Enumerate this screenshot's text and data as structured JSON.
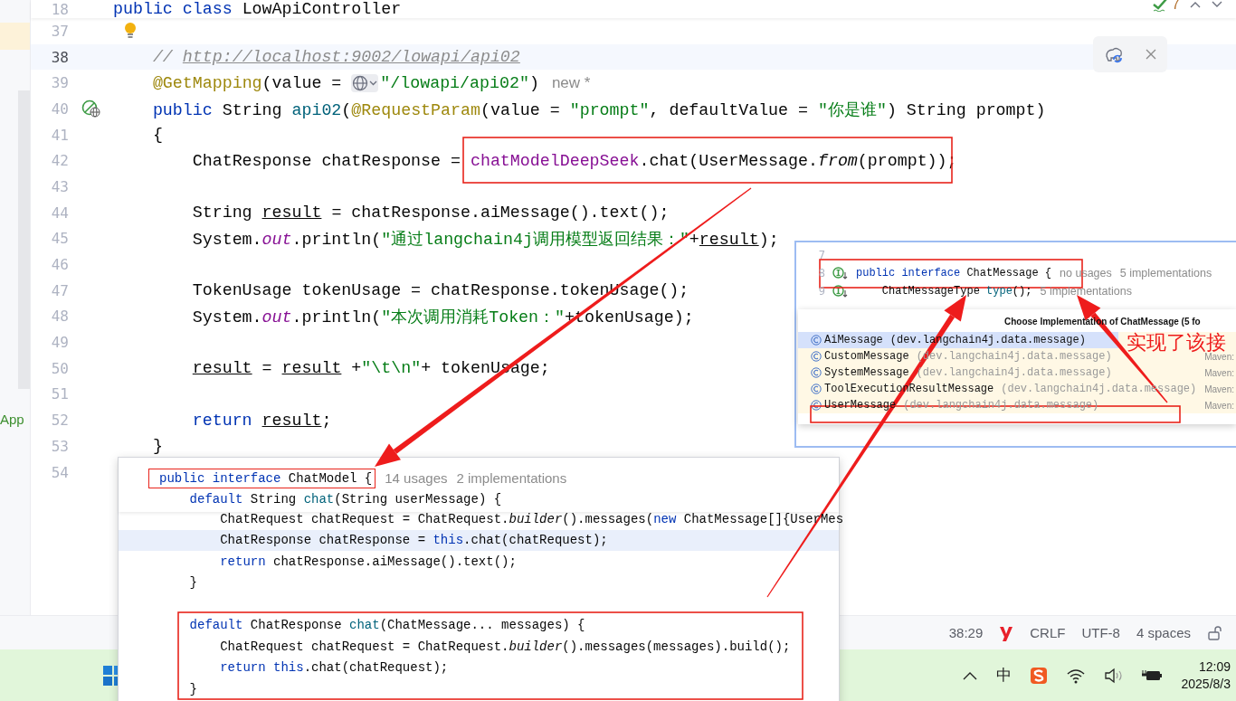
{
  "side_panel": {
    "label": "App"
  },
  "editor": {
    "sticky_line": {
      "number": "18",
      "current": false,
      "tokens": [
        {
          "kind": "kw",
          "text": "public class "
        },
        {
          "kind": "plain",
          "text": "LowApiController"
        }
      ]
    },
    "lines": [
      {
        "number": "37",
        "kind": "bulb",
        "current": false
      },
      {
        "number": "38",
        "kind": "plain",
        "current": true,
        "tokens": [
          {
            "kind": "comment",
            "text": "    // "
          },
          {
            "kind": "link",
            "text": "http://localhost:9002/lowapi/api02"
          }
        ]
      },
      {
        "number": "39",
        "kind": "plain",
        "current": false,
        "tokens": [
          {
            "kind": "ann",
            "text": "    @GetMapping"
          },
          {
            "kind": "plain",
            "text": "(value = "
          },
          {
            "kind": "globe"
          },
          {
            "kind": "str",
            "text": "\"/lowapi/api02\""
          },
          {
            "kind": "plain",
            "text": ")"
          }
        ],
        "hints": [
          "new *"
        ]
      },
      {
        "number": "40",
        "kind": "endpoint",
        "current": false,
        "tokens": [
          {
            "kind": "kw",
            "text": "    public "
          },
          {
            "kind": "plain",
            "text": "String "
          },
          {
            "kind": "decl",
            "text": "api02"
          },
          {
            "kind": "plain",
            "text": "("
          },
          {
            "kind": "ann",
            "text": "@RequestParam"
          },
          {
            "kind": "plain",
            "text": "(value = "
          },
          {
            "kind": "str",
            "text": "\"prompt\""
          },
          {
            "kind": "plain",
            "text": ", defaultValue = "
          },
          {
            "kind": "str",
            "text": "\"你是谁\""
          },
          {
            "kind": "plain",
            "text": ") String prompt)"
          }
        ]
      },
      {
        "number": "41",
        "kind": "plain",
        "current": false,
        "tokens": [
          {
            "kind": "plain",
            "text": "    {"
          }
        ]
      },
      {
        "number": "42",
        "kind": "plain",
        "current": false,
        "tokens": [
          {
            "kind": "plain",
            "text": "        ChatResponse chatResponse = "
          },
          {
            "kind": "field",
            "text": "chatModelDeepSeek"
          },
          {
            "kind": "plain",
            "text": ".chat(UserMessage."
          },
          {
            "kind": "italic",
            "text": "from"
          },
          {
            "kind": "plain",
            "text": "(prompt));"
          }
        ]
      },
      {
        "number": "43",
        "kind": "plain",
        "current": false
      },
      {
        "number": "44",
        "kind": "plain",
        "current": false,
        "tokens": [
          {
            "kind": "plain",
            "text": "        String "
          },
          {
            "kind": "var",
            "text": "result"
          },
          {
            "kind": "plain",
            "text": " = chatResponse.aiMessage().text();"
          }
        ]
      },
      {
        "number": "45",
        "kind": "plain",
        "current": false,
        "tokens": [
          {
            "kind": "plain",
            "text": "        System."
          },
          {
            "kind": "static",
            "text": "out"
          },
          {
            "kind": "plain",
            "text": ".println("
          },
          {
            "kind": "str",
            "text": "\"通过langchain4j调用模型返回结果：\""
          },
          {
            "kind": "plain",
            "text": "+"
          },
          {
            "kind": "var",
            "text": "result"
          },
          {
            "kind": "plain",
            "text": ");"
          }
        ]
      },
      {
        "number": "46",
        "kind": "plain",
        "current": false
      },
      {
        "number": "47",
        "kind": "plain",
        "current": false,
        "tokens": [
          {
            "kind": "plain",
            "text": "        TokenUsage tokenUsage = chatResponse.tokenUsage();"
          }
        ]
      },
      {
        "number": "48",
        "kind": "plain",
        "current": false,
        "tokens": [
          {
            "kind": "plain",
            "text": "        System."
          },
          {
            "kind": "static",
            "text": "out"
          },
          {
            "kind": "plain",
            "text": ".println("
          },
          {
            "kind": "str",
            "text": "\"本次调用消耗Token：\""
          },
          {
            "kind": "plain",
            "text": "+tokenUsage);"
          }
        ]
      },
      {
        "number": "49",
        "kind": "plain",
        "current": false
      },
      {
        "number": "50",
        "kind": "plain",
        "current": false,
        "tokens": [
          {
            "kind": "var",
            "text": "        result"
          },
          {
            "kind": "plain",
            "text": " = "
          },
          {
            "kind": "var",
            "text": "result"
          },
          {
            "kind": "plain",
            "text": " +"
          },
          {
            "kind": "str",
            "text": "\"\\t\\n\""
          },
          {
            "kind": "plain",
            "text": "+ tokenUsage;"
          }
        ]
      },
      {
        "number": "51",
        "kind": "plain",
        "current": false
      },
      {
        "number": "52",
        "kind": "plain",
        "current": false,
        "tokens": [
          {
            "kind": "kw",
            "text": "        return "
          },
          {
            "kind": "var",
            "text": "result"
          },
          {
            "kind": "plain",
            "text": ";"
          }
        ]
      },
      {
        "number": "53",
        "kind": "plain",
        "current": false,
        "tokens": [
          {
            "kind": "plain",
            "text": "    }"
          }
        ]
      },
      {
        "number": "54",
        "kind": "plain",
        "current": false
      }
    ]
  },
  "inspection": {
    "count": "7"
  },
  "chat_model_popup": {
    "sticky_lines": [
      {
        "tokens": [
          {
            "kind": "kw",
            "text": "public interface "
          },
          {
            "kind": "plain",
            "text": "ChatModel {"
          }
        ],
        "hints": [
          "14 usages",
          "2 implementations"
        ]
      },
      {
        "tokens": [
          {
            "kind": "kw",
            "text": "    default "
          },
          {
            "kind": "plain",
            "text": "String "
          },
          {
            "kind": "decl",
            "text": "chat"
          },
          {
            "kind": "plain",
            "text": "(String userMessage) {"
          }
        ]
      }
    ],
    "lines": [
      {
        "current": false,
        "tokens": [
          {
            "kind": "plain",
            "text": "        ChatRequest chatRequest = ChatRequest."
          },
          {
            "kind": "italic",
            "text": "builder"
          },
          {
            "kind": "plain",
            "text": "().messages("
          },
          {
            "kind": "kw",
            "text": "new "
          },
          {
            "kind": "plain",
            "text": "ChatMessage[]{UserMes"
          }
        ]
      },
      {
        "current": true,
        "tokens": [
          {
            "kind": "plain",
            "text": "        ChatResponse chatResponse = "
          },
          {
            "kind": "kw",
            "text": "this"
          },
          {
            "kind": "plain",
            "text": ".chat(chatRequest);"
          }
        ]
      },
      {
        "current": false,
        "tokens": [
          {
            "kind": "kw",
            "text": "        return "
          },
          {
            "kind": "plain",
            "text": "chatResponse.aiMessage().text();"
          }
        ]
      },
      {
        "current": false,
        "tokens": [
          {
            "kind": "plain",
            "text": "    }"
          }
        ]
      },
      {
        "current": false
      },
      {
        "current": false,
        "tokens": [
          {
            "kind": "kw",
            "text": "    default "
          },
          {
            "kind": "plain",
            "text": "ChatResponse "
          },
          {
            "kind": "decl",
            "text": "chat"
          },
          {
            "kind": "plain",
            "text": "(ChatMessage... messages) {"
          }
        ]
      },
      {
        "current": false,
        "tokens": [
          {
            "kind": "plain",
            "text": "        ChatRequest chatRequest = ChatRequest."
          },
          {
            "kind": "italic",
            "text": "builder"
          },
          {
            "kind": "plain",
            "text": "().messages(messages).build();"
          }
        ]
      },
      {
        "current": false,
        "tokens": [
          {
            "kind": "kw",
            "text": "        return this"
          },
          {
            "kind": "plain",
            "text": ".chat(chatRequest);"
          }
        ]
      },
      {
        "current": false,
        "tokens": [
          {
            "kind": "plain",
            "text": "    }"
          }
        ]
      }
    ]
  },
  "chat_message_popup": {
    "lines": [
      {
        "number": "7",
        "kind": "plain"
      },
      {
        "number": "8",
        "kind": "implemented",
        "tokens": [
          {
            "kind": "kw",
            "text": "public interface "
          },
          {
            "kind": "plain",
            "text": "ChatMessage {"
          }
        ],
        "hints": [
          "no usages",
          "5 implementations"
        ]
      },
      {
        "number": "9",
        "kind": "implemented",
        "tokens": [
          {
            "kind": "plain",
            "text": "    ChatMessageType "
          },
          {
            "kind": "decl",
            "text": "type"
          },
          {
            "kind": "plain",
            "text": "();"
          }
        ],
        "hints": [
          "5 implementations"
        ]
      }
    ],
    "chooser": {
      "title": "Choose Implementation of ChatMessage (5 fo",
      "items": [
        {
          "name": "AiMessage",
          "package": "(dev.langchain4j.data.message)",
          "selected": true
        },
        {
          "name": "CustomMessage",
          "package": "(dev.langchain4j.data.message)",
          "location": "Maven:",
          "selected": false
        },
        {
          "name": "SystemMessage",
          "package": "(dev.langchain4j.data.message)",
          "location": "Maven:",
          "selected": false
        },
        {
          "name": "ToolExecutionResultMessage",
          "package": "(dev.langchain4j.data.message)",
          "location": "Maven:",
          "selected": false
        },
        {
          "name": "UserMessage",
          "package": "(dev.langchain4j.data.message)",
          "location": "Maven:",
          "selected": false
        }
      ]
    }
  },
  "annotation": {
    "note": "实现了该接"
  },
  "status_bar": {
    "position": "38:29",
    "line_separator": "CRLF",
    "encoding": "UTF-8",
    "indent": "4 spaces"
  },
  "taskbar": {
    "input_method": "中",
    "time": "12:09",
    "date": "2025/8/3"
  }
}
